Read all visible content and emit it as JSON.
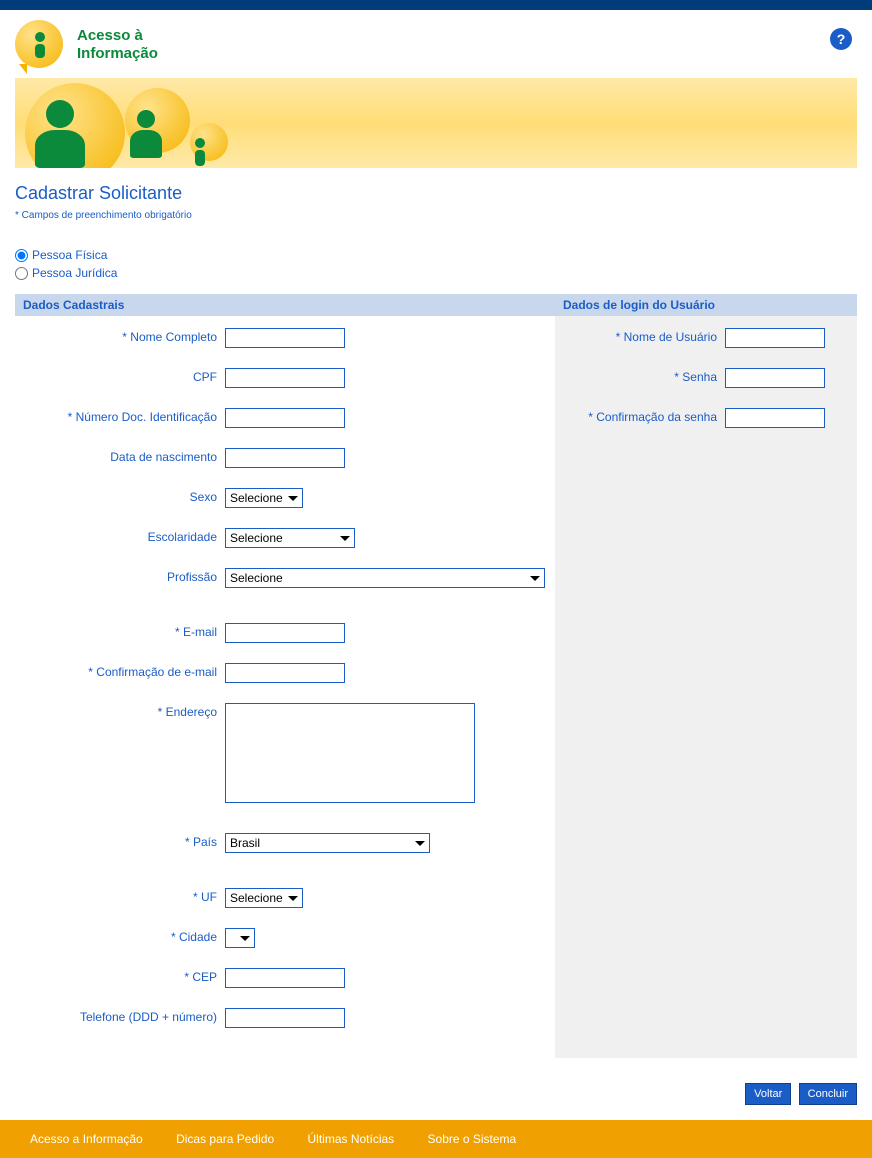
{
  "header": {
    "brand_line1": "Acesso à",
    "brand_line2": "Informação",
    "help_icon": "?"
  },
  "page": {
    "title": "Cadastrar Solicitante",
    "required_note": "* Campos de preenchimento obrigatório"
  },
  "radios": {
    "pessoa_fisica": "Pessoa Física",
    "pessoa_juridica": "Pessoa Jurídica"
  },
  "sections": {
    "cadastrais": "Dados Cadastrais",
    "login": "Dados de login do Usuário"
  },
  "fields": {
    "nome_completo": "* Nome Completo",
    "cpf": "CPF",
    "num_doc": "* Número Doc. Identificação",
    "data_nasc": "Data de nascimento",
    "sexo": "Sexo",
    "escolaridade": "Escolaridade",
    "profissao": "Profissão",
    "email": "* E-mail",
    "conf_email": "* Confirmação de e-mail",
    "endereco": "* Endereço",
    "pais": "* País",
    "uf": "* UF",
    "cidade": "* Cidade",
    "cep": "* CEP",
    "telefone": "Telefone (DDD + número)",
    "nome_usuario": "* Nome de Usuário",
    "senha": "* Senha",
    "conf_senha": "* Confirmação da senha"
  },
  "selects": {
    "selecione": "Selecione",
    "pais_value": "Brasil",
    "cidade_value": ""
  },
  "buttons": {
    "voltar": "Voltar",
    "concluir": "Concluir"
  },
  "footer": {
    "link1": "Acesso a Informação",
    "link2": "Dicas para Pedido",
    "link3": "Últimas Notícias",
    "link4": "Sobre o Sistema"
  }
}
